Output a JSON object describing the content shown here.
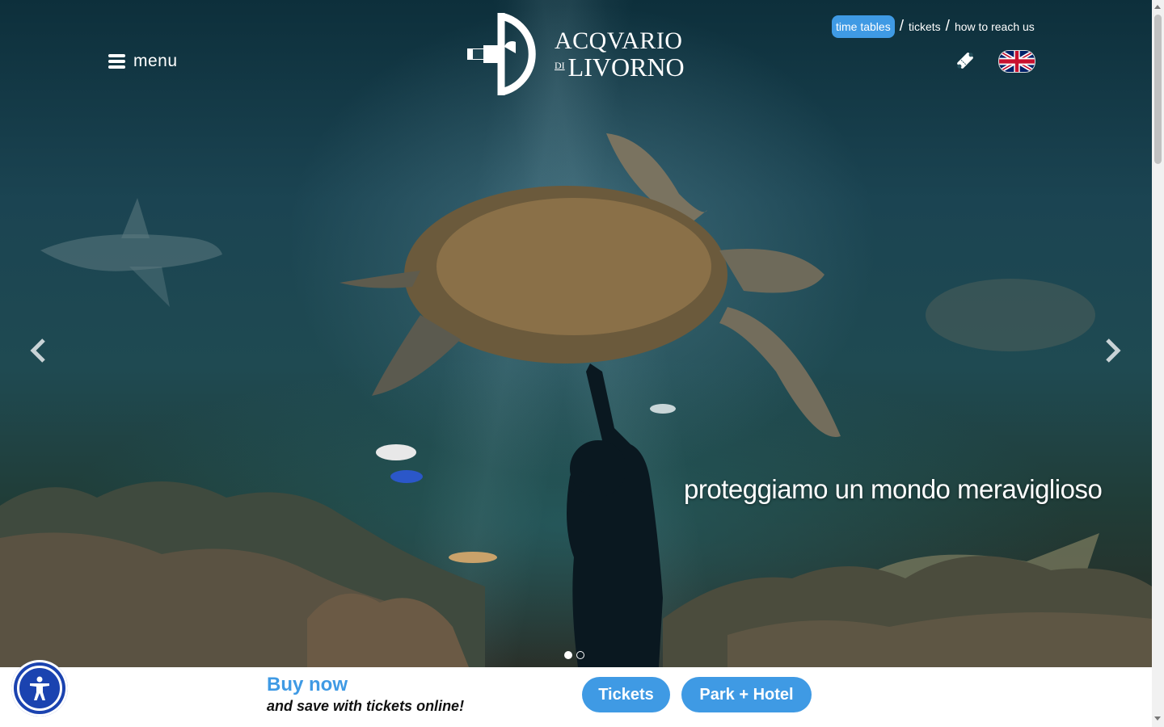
{
  "header": {
    "menu_label": "menu",
    "logo": {
      "line1": "ACQVARIO",
      "di": "DI",
      "line2": "LIVORNO"
    },
    "top_links": [
      {
        "label": "time tables",
        "active": true
      },
      {
        "label": "tickets",
        "active": false
      },
      {
        "label": "how to reach us",
        "active": false
      }
    ],
    "separator": "/",
    "ticket_icon": "ticket-icon",
    "language_flag": "uk-flag-icon"
  },
  "hero": {
    "caption": "proteggiamo un mondo meraviglioso",
    "slide_count": 2,
    "active_slide": 1,
    "prev_icon": "chevron-left-icon",
    "next_icon": "chevron-right-icon"
  },
  "cta_bar": {
    "title": "Buy now",
    "subtitle": "and save with tickets online!",
    "buttons": {
      "tickets": "Tickets",
      "park_hotel": "Park + Hotel"
    }
  },
  "accessibility": {
    "icon": "accessibility-icon"
  },
  "colors": {
    "accent": "#3f9ae4",
    "accessibility_blue": "#1b43b0"
  }
}
